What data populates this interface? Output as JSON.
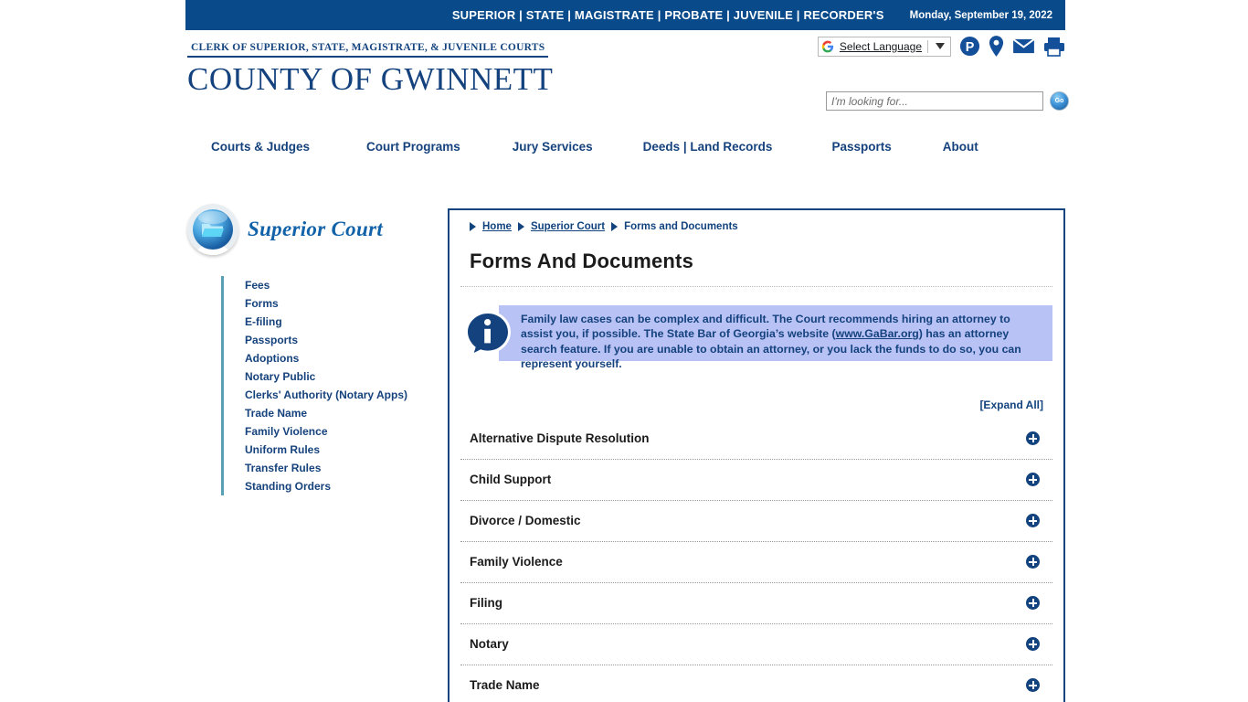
{
  "topbar": {
    "courts": "SUPERIOR | STATE | MAGISTRATE | PROBATE | JUVENILE | RECORDER'S",
    "date": "Monday, September 19, 2022",
    "bg_color": "#084a8a"
  },
  "brand": {
    "subtitle": "CLERK OF SUPERIOR, STATE, MAGISTRATE, & JUVENILE COURTS",
    "title": "COUNTY OF GWINNETT",
    "color": "#14427e"
  },
  "utilities": {
    "translate_label": "Select Language",
    "google_icon": "google-g-icon",
    "caret_icon": "chevron-down-icon",
    "icons": [
      {
        "name": "parking-icon",
        "glyph": "P"
      },
      {
        "name": "location-pin-icon",
        "glyph": "•"
      },
      {
        "name": "envelope-icon",
        "glyph": "✉"
      },
      {
        "name": "printer-icon",
        "glyph": "⎙"
      }
    ]
  },
  "search": {
    "placeholder": "I'm looking for...",
    "value": "",
    "go_label": "Go"
  },
  "mainnav": {
    "items": [
      {
        "label": "Courts & Judges"
      },
      {
        "label": "Court Programs"
      },
      {
        "label": "Jury Services"
      },
      {
        "label": "Deeds | Land Records"
      },
      {
        "label": "Passports"
      },
      {
        "label": "About"
      }
    ]
  },
  "sidebar": {
    "logo_title": "Superior Court",
    "logo_icon": "folder-orb-icon",
    "items": [
      {
        "label": "Fees"
      },
      {
        "label": "Forms"
      },
      {
        "label": "E-filing"
      },
      {
        "label": "Passports"
      },
      {
        "label": "Adoptions"
      },
      {
        "label": "Notary Public"
      },
      {
        "label": "Clerks' Authority (Notary Apps)"
      },
      {
        "label": "Trade Name"
      },
      {
        "label": "Family Violence"
      },
      {
        "label": "Uniform Rules"
      },
      {
        "label": "Transfer Rules"
      },
      {
        "label": "Standing Orders"
      }
    ],
    "accent_color": "#59a0b4"
  },
  "content": {
    "breadcrumb": [
      {
        "label": "Home",
        "link": true
      },
      {
        "label": "Superior Court",
        "link": true
      },
      {
        "label": "Forms and Documents",
        "link": false
      }
    ],
    "page_title": "Forms And Documents",
    "callout": {
      "icon": "info-icon",
      "text_before_link": "Family law cases can be complex and difficult. The Court recommends hiring an attorney to assist you, if possible. The State Bar of Georgia’s website (",
      "link_text": "www.GaBar.org",
      "text_after_link": ") has an attorney search feature. If you are unable to obtain an attorney, or you lack the funds to do so, you can represent yourself.",
      "bg_color": "#b9c2f5"
    },
    "expand_all": "[Expand All]",
    "accordion": [
      {
        "label": "Alternative Dispute Resolution",
        "icon": "plus-circle-icon"
      },
      {
        "label": "Child Support",
        "icon": "plus-circle-icon"
      },
      {
        "label": "Divorce / Domestic",
        "icon": "plus-circle-icon"
      },
      {
        "label": "Family Violence",
        "icon": "plus-circle-icon"
      },
      {
        "label": "Filing",
        "icon": "plus-circle-icon"
      },
      {
        "label": "Notary",
        "icon": "plus-circle-icon"
      },
      {
        "label": "Trade Name",
        "icon": "plus-circle-icon"
      }
    ]
  }
}
